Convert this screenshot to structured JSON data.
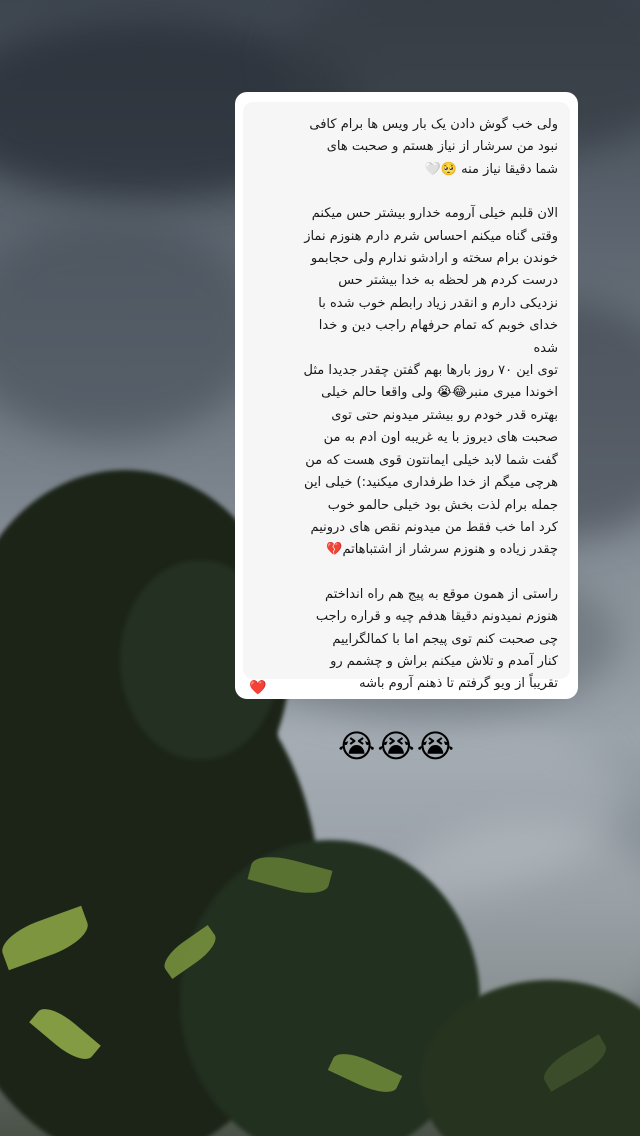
{
  "story": {
    "message": {
      "p1": "ولی خب گوش دادن یک بار ویس ها برام کافی\nنبود من سرشار از نیاز هستم و صحبت های\nشما دقیقا نیاز منه 🥺🤍",
      "p2": "الان قلبم خیلی آرومه خدارو بیشتر حس میکنم\nوقتی گناه میکنم احساس شرم دارم هنوزم نماز\nخوندن برام سخته و ارادشو ندارم ولی حجابمو\nدرست کردم هر لحظه به خدا بیشتر حس\nنزدیکی دارم و انقدر زیاد رابطم خوب شده با\nخدای خوبم که تمام حرفهام راجب دین و خدا\nشده\nتوی این ۷۰ روز بارها بهم گفتن چقدر جدیدا مثل\nاخوندا میری منبر😂😭 ولی واقعا حالم خیلی\nبهتره قدر خودم رو بیشتر میدونم حتی توی\nصحبت های دیروز با یه غریبه اون ادم به من\nگفت شما لابد خیلی ایمانتون قوی هست که من\nهرچی میگم از خدا طرفداری میکنید:) خیلی این\nجمله برام لذت بخش بود خیلی حالمو خوب\nکرد اما خب فقط من میدونم نقص های درونیم\nچقدر زیاده و هنوزم سرشار از اشتباهاتم💔",
      "p3": "راستی از همون موقع به پیج هم راه انداختم\nهنوزم نمیدونم دقیقا هدفم چیه و قراره راجب\nچی صحبت کنم  توی پیجم اما با کمالگراییم\nکنار آمدم و تلاش میکنم براش و چشمم رو\nتقریباً از ویو گرفتم تا ذهنم آروم باشه"
    },
    "reaction": "❤️",
    "caption": "😭😭😭"
  }
}
